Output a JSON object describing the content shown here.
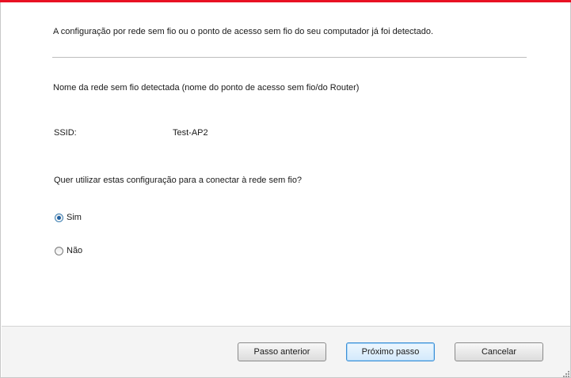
{
  "window": {
    "accent_color": "#e81123"
  },
  "content": {
    "intro": "A configuração por rede sem fio ou o ponto de acesso sem fio do seu computador já foi detectado.",
    "network_heading": "Nome da rede sem fio detectada (nome do ponto de acesso sem fio/do Router)",
    "ssid_label": "SSID:",
    "ssid_value": "Test-AP2",
    "question": "Quer utilizar estas configuração para a conectar à rede sem fio?",
    "options": [
      {
        "label": "Sim",
        "selected": true
      },
      {
        "label": "Não",
        "selected": false
      }
    ]
  },
  "footer": {
    "prev_label": "Passo anterior",
    "next_label": "Próximo passo",
    "cancel_label": "Cancelar"
  }
}
